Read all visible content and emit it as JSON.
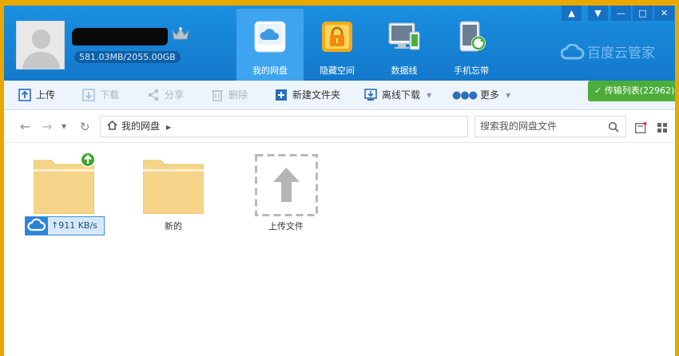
{
  "header": {
    "quota": "581.03MB/2055.00GB",
    "tabs": [
      {
        "label": "我的网盘",
        "icon": "cloud-disk-icon",
        "active": true
      },
      {
        "label": "隐藏空间",
        "icon": "lock-icon",
        "active": false
      },
      {
        "label": "数据线",
        "icon": "devices-icon",
        "active": false
      },
      {
        "label": "手机忘带",
        "icon": "phone-sync-icon",
        "active": false
      }
    ],
    "brand": "百度云管家",
    "window_controls": [
      "bell-icon",
      "dropdown-icon",
      "minimize-icon",
      "maximize-icon",
      "close-icon"
    ]
  },
  "toolbar": {
    "upload": "上传",
    "download": "下载",
    "share": "分享",
    "delete": "删除",
    "new_folder": "新建文件夹",
    "offline_download": "离线下载",
    "more": "更多",
    "transfer_list": "传输列表(22962)"
  },
  "navbar": {
    "path_root": "我的网盘",
    "search_placeholder": "搜索我的网盘文件"
  },
  "files": [
    {
      "name": "",
      "type": "folder",
      "uploading": true
    },
    {
      "name": "新的",
      "type": "folder"
    },
    {
      "name": "上传文件",
      "type": "upload-placeholder"
    }
  ],
  "upload_speed": "911 KB/s",
  "colors": {
    "header_blue": "#1a8fe0",
    "active_tab": "#3ea4ef",
    "transfer_green": "#4cae3a",
    "folder": "#f5d48a",
    "window_border": "#e9a800"
  }
}
